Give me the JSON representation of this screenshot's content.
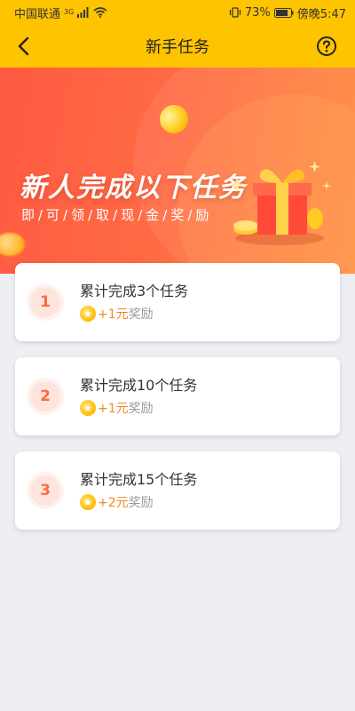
{
  "status_bar": {
    "carrier": "中国联通",
    "network": "3G",
    "battery": "73%",
    "time": "傍晚5:47"
  },
  "nav": {
    "title": "新手任务"
  },
  "banner": {
    "title": "新人完成以下任务",
    "subtitle": "即/可/领/取/现/金/奖/励"
  },
  "tasks": [
    {
      "number": "1",
      "title": "累计完成3个任务",
      "amount": "+1元",
      "label": "奖励"
    },
    {
      "number": "2",
      "title": "累计完成10个任务",
      "amount": "+1元",
      "label": "奖励"
    },
    {
      "number": "3",
      "title": "累计完成15个任务",
      "amount": "+2元",
      "label": "奖励"
    }
  ],
  "colors": {
    "header": "#ffc400",
    "banner": "#ff5a42",
    "accent": "#ff6a3d",
    "reward": "#f08a24"
  }
}
